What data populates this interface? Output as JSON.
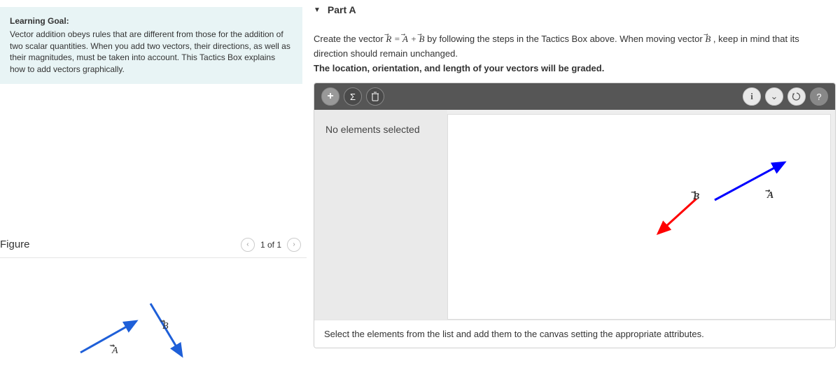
{
  "left": {
    "learning_goal_title": "Learning Goal:",
    "learning_goal_text": "Vector addition obeys rules that are different from those for the addition of two scalar quantities. When you add two vectors, their directions, as well as their magnitudes, must be taken into account. This Tactics Box explains how to add vectors graphically.",
    "figure_title": "Figure",
    "figure_counter": "1 of 1",
    "vec_a_label": "A",
    "vec_b_label": "B"
  },
  "right": {
    "part_label": "Part A",
    "instruction_prefix": "Create the vector ",
    "eq_r": "R",
    "eq_eq": " = ",
    "eq_a": "A",
    "eq_plus": " + ",
    "eq_b": "B",
    "instruction_mid": " by following the steps in the Tactics Box above. When moving vector ",
    "instruction_b2": "B",
    "instruction_suffix": ", keep in mind that its direction should remain unchanged.",
    "instruction_bold": "The location, orientation, and length of your vectors will be graded.",
    "props_empty": "No elements selected",
    "canvas_a_label": "A",
    "canvas_b_label": "B",
    "footer_hint": "Select the elements from the list and add them to the canvas setting the appropriate attributes."
  },
  "toolbar": {
    "add": "+",
    "sum": "Σ",
    "delete": "🗑",
    "info": "i",
    "expand": "⌄",
    "reset": "↺",
    "help": "?"
  }
}
